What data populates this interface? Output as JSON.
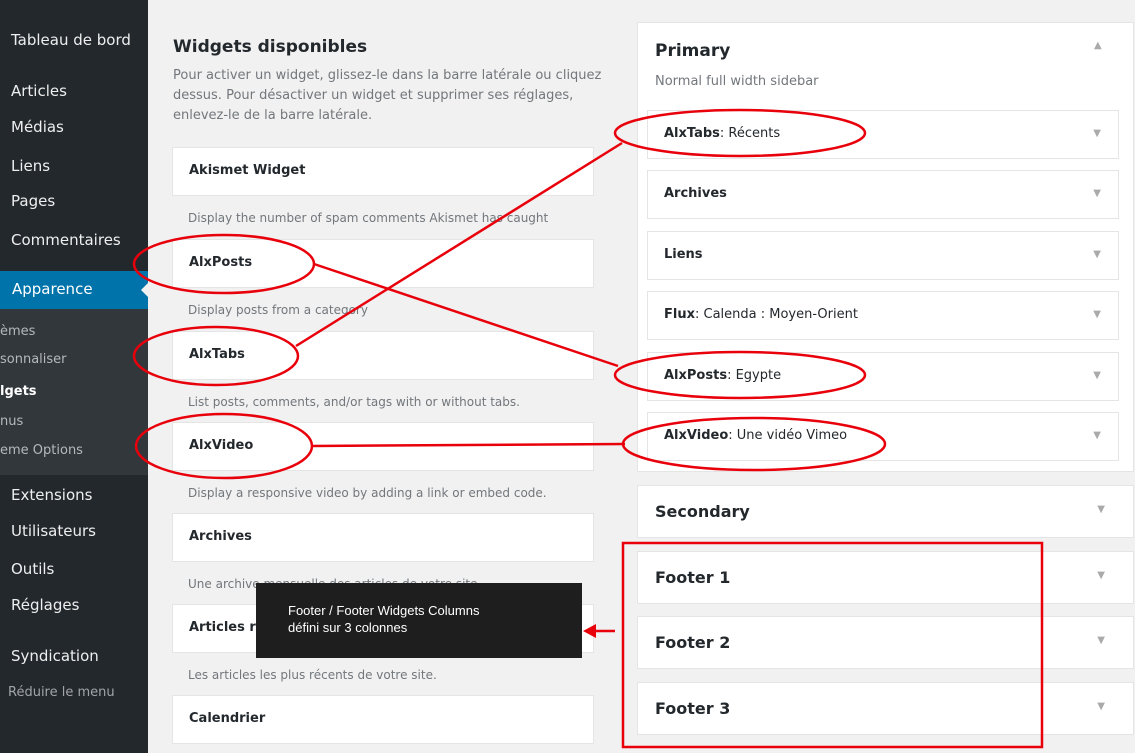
{
  "menu": {
    "dashboard": "Tableau de bord",
    "articles": "Articles",
    "medias": "Médias",
    "liens": "Liens",
    "pages": "Pages",
    "commentaires": "Commentaires",
    "apparence": "Apparence",
    "sub": [
      "èmes",
      "sonnaliser",
      "lgets",
      "nus",
      "eme Options"
    ],
    "extensions": "Extensions",
    "utilisateurs": "Utilisateurs",
    "outils": "Outils",
    "reglages": "Réglages",
    "syndication": "Syndication",
    "reduire": "Réduire le menu"
  },
  "available": {
    "title": "Widgets disponibles",
    "desc": "Pour activer un widget, glissez-le dans la barre latérale ou cliquez dessus. Pour désactiver un widget et supprimer ses réglages, enlevez-le de la barre latérale.",
    "widgets": [
      {
        "name": "Akismet Widget",
        "desc": "Display the number of spam comments Akismet has caught"
      },
      {
        "name": "AlxPosts",
        "desc": "Display posts from a category"
      },
      {
        "name": "AlxTabs",
        "desc": "List posts, comments, and/or tags with or without tabs."
      },
      {
        "name": "AlxVideo",
        "desc": "Display a responsive video by adding a link or embed code."
      },
      {
        "name": "Archives",
        "desc": "Une archive mensuelle des articles de votre site"
      },
      {
        "name": "Articles récents",
        "desc": "Les articles les plus récents de votre site."
      },
      {
        "name": "Calendrier",
        "desc": ""
      }
    ]
  },
  "primary": {
    "title": "Primary",
    "desc": "Normal full width sidebar",
    "widgets": [
      {
        "name": "AlxTabs",
        "title": ": Récents"
      },
      {
        "name": "Archives",
        "title": ""
      },
      {
        "name": "Liens",
        "title": ""
      },
      {
        "name": "Flux",
        "title": ": Calenda : Moyen-Orient"
      },
      {
        "name": "AlxPosts",
        "title": ": Egypte"
      },
      {
        "name": "AlxVideo",
        "title": ": Une vidéo Vimeo"
      }
    ]
  },
  "sidebars": [
    "Secondary",
    "Footer 1",
    "Footer 2",
    "Footer 3"
  ],
  "tooltip": {
    "line1": "Footer / Footer Widgets Columns",
    "line2": "défini sur 3 colonnes"
  },
  "icons": {
    "collapse_up": "up-arrow-icon",
    "expand_down": "down-arrow-icon"
  },
  "colors": {
    "sidebar_bg": "#23282d",
    "active_menu": "#0073aa",
    "annotation": "#e8000b"
  }
}
